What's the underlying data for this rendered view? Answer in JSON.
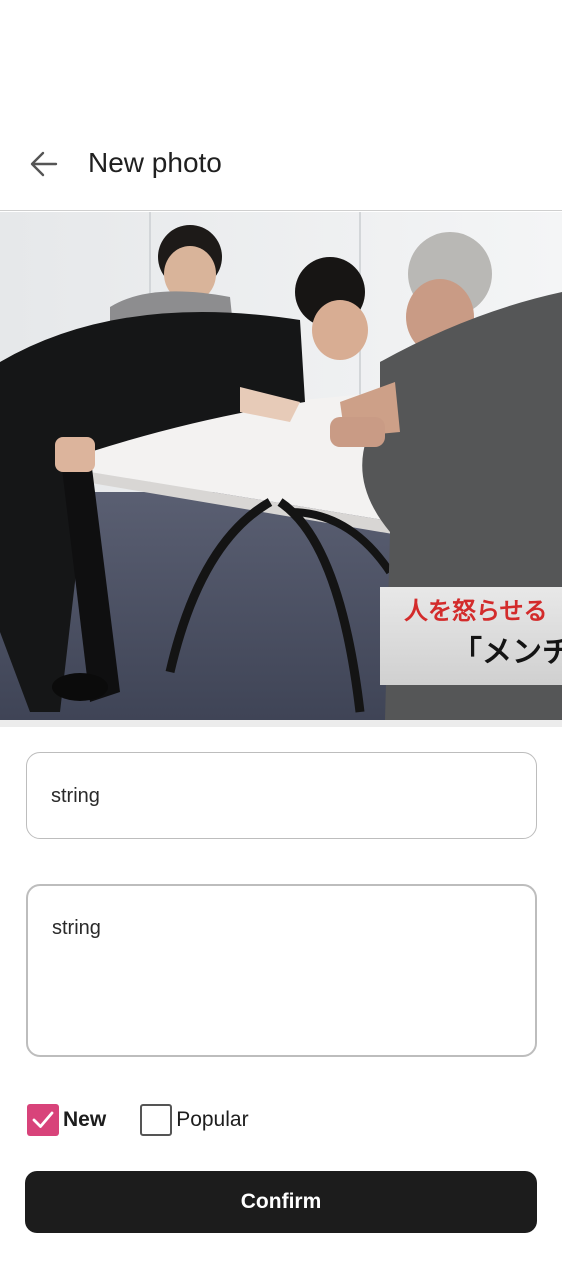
{
  "header": {
    "title": "New photo",
    "back_icon": "arrow-left-icon"
  },
  "photo": {
    "caption_line1": "人を怒らせる",
    "caption_line2": "「メンチ"
  },
  "form": {
    "title_value": "string",
    "description_value": "string"
  },
  "tags": [
    {
      "label": "New",
      "checked": true
    },
    {
      "label": "Popular",
      "checked": false
    }
  ],
  "confirm_label": "Confirm",
  "colors": {
    "accent": "#d8437a",
    "button": "#1c1c1c"
  }
}
